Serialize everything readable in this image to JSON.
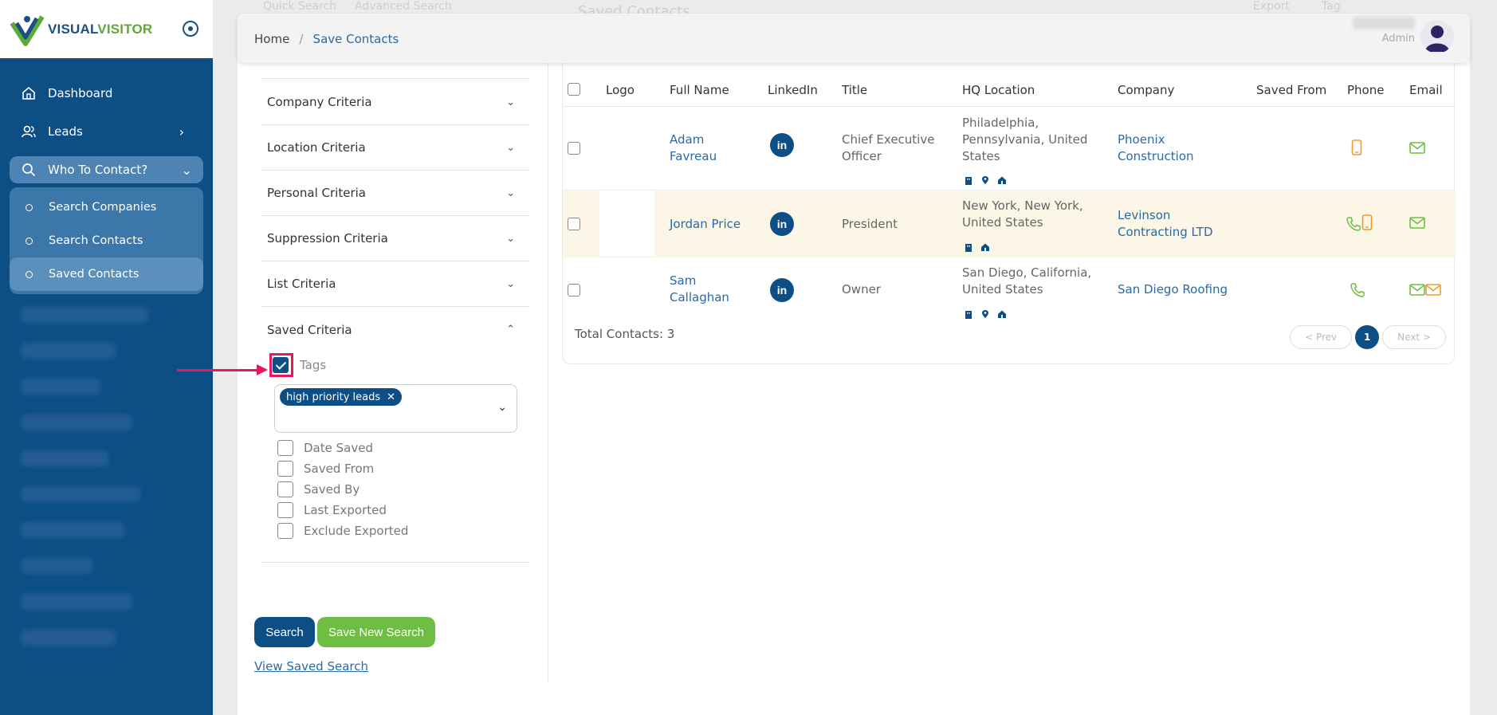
{
  "brand": {
    "part1": "VISUAL",
    "part2": "VISITOR"
  },
  "nav": {
    "dashboard": "Dashboard",
    "leads": "Leads",
    "who": "Who To Contact?",
    "sub": [
      "Search Companies",
      "Search Contacts",
      "Saved Contacts"
    ]
  },
  "ghost": {
    "quick": "Quick Search",
    "advanced": "Advanced Search",
    "saved_title": "Saved Contacts",
    "export": "Export",
    "tag": "Tag"
  },
  "breadcrumb": {
    "home": "Home",
    "current": "Save Contacts"
  },
  "user": {
    "role": "Admin"
  },
  "criteria": [
    "Company Criteria",
    "Location Criteria",
    "Personal Criteria",
    "Suppression Criteria",
    "List Criteria",
    "Saved Criteria"
  ],
  "tags": {
    "label": "Tags",
    "pill": "high priority leads"
  },
  "options": [
    "Date Saved",
    "Saved From",
    "Saved By",
    "Last Exported",
    "Exclude Exported"
  ],
  "buttons": {
    "search": "Search",
    "save_new": "Save New Search",
    "view_saved": "View Saved Search"
  },
  "table": {
    "headers": [
      "Logo",
      "Full Name",
      "LinkedIn",
      "Title",
      "HQ Location",
      "Company",
      "Saved From",
      "Phone",
      "Email"
    ],
    "rows": [
      {
        "name_line1": "Adam",
        "name_line2": "Favreau",
        "title_line1": "Chief Executive",
        "title_line2": "Officer",
        "loc_line1": "Philadelphia,",
        "loc_line2": "Pennsylvania, United",
        "loc_line3": "States",
        "company_line1": "Phoenix",
        "company_line2": "Construction"
      },
      {
        "name_line1": "Jordan Price",
        "title_line1": "President",
        "loc_line1": "New York, New York,",
        "loc_line2": "United States",
        "company_line1": "Levinson",
        "company_line2": "Contracting LTD"
      },
      {
        "name_line1": "Sam",
        "name_line2": "Callaghan",
        "title_line1": "Owner",
        "loc_line1": "San Diego, California,",
        "loc_line2": "United States",
        "company_line1": "San Diego Roofing"
      }
    ],
    "linkedin_glyph": "in",
    "total": "Total Contacts: 3"
  },
  "pager": {
    "prev": "< Prev",
    "page": "1",
    "next": "Next >"
  },
  "colors": {
    "primary": "#0d4e85",
    "green": "#6fbe44",
    "highlight": "#e8175d",
    "orange": "#f29a2e",
    "link": "#2a6aa6"
  }
}
